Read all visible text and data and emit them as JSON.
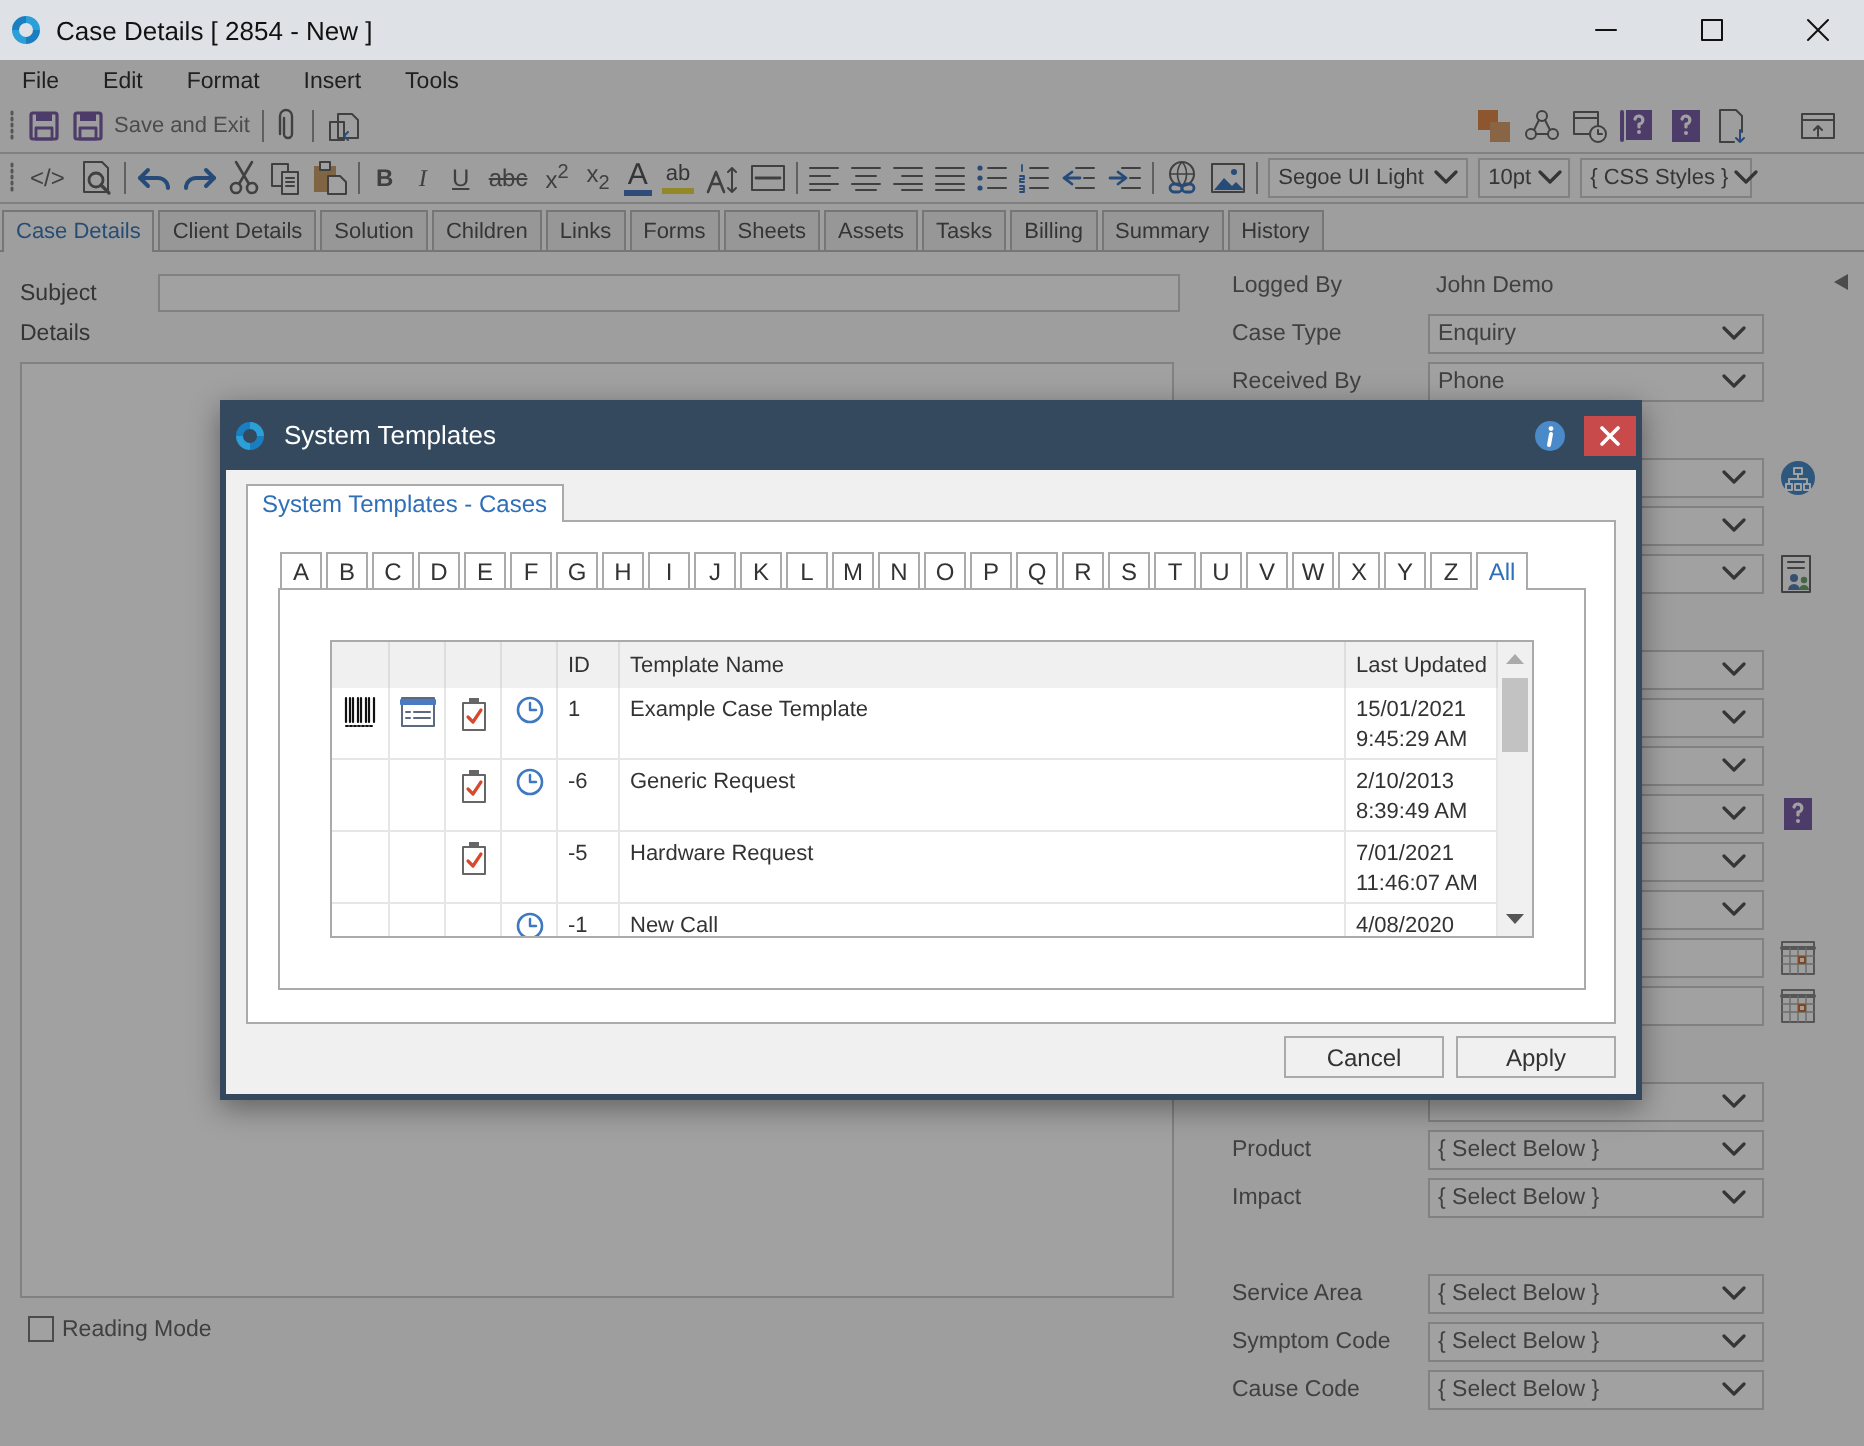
{
  "window": {
    "title": "Case Details [ 2854 - New ]"
  },
  "menu": [
    "File",
    "Edit",
    "Format",
    "Insert",
    "Tools"
  ],
  "toolbar": {
    "save_exit": "Save and Exit"
  },
  "format_toolbar": {
    "source": "</>",
    "text_buttons": [
      "B",
      "I",
      "U",
      "abc",
      "x$^{2}$",
      "x$_{2}$"
    ],
    "font_color": "A",
    "highlight": "ab",
    "font": "Segoe UI Light",
    "size": "10pt",
    "styles": "{ CSS Styles }"
  },
  "tabs": [
    {
      "label": "Case Details",
      "selected": true
    },
    {
      "label": "Client Details",
      "selected": false
    },
    {
      "label": "Solution",
      "selected": false
    },
    {
      "label": "Children",
      "selected": false
    },
    {
      "label": "Links",
      "selected": false
    },
    {
      "label": "Forms",
      "selected": false
    },
    {
      "label": "Sheets",
      "selected": false
    },
    {
      "label": "Assets",
      "selected": false
    },
    {
      "label": "Tasks",
      "selected": false
    },
    {
      "label": "Billing",
      "selected": false
    },
    {
      "label": "Summary",
      "selected": false
    },
    {
      "label": "History",
      "selected": false
    }
  ],
  "form": {
    "subject_label": "Subject",
    "details_label": "Details",
    "reading_mode": {
      "label": "Reading Mode",
      "checked": false
    }
  },
  "side_panel": {
    "logged_by_label": "Logged By",
    "logged_by": "John Demo",
    "sections": [
      [
        {
          "kind": "select",
          "label": "Case Type",
          "value": "Enquiry"
        },
        {
          "kind": "select",
          "label": "Received By",
          "value": "Phone"
        }
      ],
      [
        {
          "kind": "select"
        },
        {
          "kind": "select"
        },
        {
          "kind": "select"
        }
      ],
      [
        {
          "kind": "select"
        },
        {
          "kind": "select"
        },
        {
          "kind": "select"
        },
        {
          "kind": "select"
        },
        {
          "kind": "select"
        },
        {
          "kind": "select"
        },
        {
          "kind": "date"
        },
        {
          "kind": "date"
        }
      ],
      [
        {
          "kind": "select"
        },
        {
          "kind": "select",
          "label": "Product",
          "value": "{ Select Below }"
        },
        {
          "kind": "select",
          "label": "Impact",
          "value": "{ Select Below }"
        }
      ],
      [
        {
          "kind": "select",
          "label": "Service Area",
          "value": "{ Select Below }"
        },
        {
          "kind": "select",
          "label": "Symptom Code",
          "value": "{ Select Below }"
        },
        {
          "kind": "select",
          "label": "Cause Code",
          "value": "{ Select Below }"
        }
      ]
    ]
  },
  "dialog": {
    "title": "System Templates",
    "tabs": [
      {
        "label": "System Templates - Cases",
        "selected": true
      }
    ],
    "letters": [
      {
        "label": "A",
        "selected": false
      },
      {
        "label": "B",
        "selected": false
      },
      {
        "label": "C",
        "selected": false
      },
      {
        "label": "D",
        "selected": false
      },
      {
        "label": "E",
        "selected": false
      },
      {
        "label": "F",
        "selected": false
      },
      {
        "label": "G",
        "selected": false
      },
      {
        "label": "H",
        "selected": false
      },
      {
        "label": "I",
        "selected": false
      },
      {
        "label": "J",
        "selected": false
      },
      {
        "label": "K",
        "selected": false
      },
      {
        "label": "L",
        "selected": false
      },
      {
        "label": "M",
        "selected": false
      },
      {
        "label": "N",
        "selected": false
      },
      {
        "label": "O",
        "selected": false
      },
      {
        "label": "P",
        "selected": false
      },
      {
        "label": "Q",
        "selected": false
      },
      {
        "label": "R",
        "selected": false
      },
      {
        "label": "S",
        "selected": false
      },
      {
        "label": "T",
        "selected": false
      },
      {
        "label": "U",
        "selected": false
      },
      {
        "label": "V",
        "selected": false
      },
      {
        "label": "W",
        "selected": false
      },
      {
        "label": "X",
        "selected": false
      },
      {
        "label": "Y",
        "selected": false
      },
      {
        "label": "Z",
        "selected": false
      },
      {
        "label": "All",
        "selected": true
      }
    ],
    "table": {
      "columns": [
        "ID",
        "Template Name",
        "Last Updated"
      ],
      "rows": [
        {
          "barcode": true,
          "form": true,
          "checklist": true,
          "clock": true,
          "id": "1",
          "name": "Example Case Template",
          "updated": "15/01/2021\n9:45:29 AM"
        },
        {
          "barcode": false,
          "form": false,
          "checklist": true,
          "clock": true,
          "id": "-6",
          "name": "Generic Request",
          "updated": "2/10/2013\n8:39:49 AM"
        },
        {
          "barcode": false,
          "form": false,
          "checklist": true,
          "clock": false,
          "id": "-5",
          "name": "Hardware Request",
          "updated": "7/01/2021\n11:46:07 AM"
        },
        {
          "barcode": false,
          "form": false,
          "checklist": false,
          "clock": true,
          "id": "-1",
          "name": "New Call",
          "updated": "4/08/2020"
        }
      ]
    },
    "buttons": [
      "Cancel",
      "Apply"
    ]
  }
}
